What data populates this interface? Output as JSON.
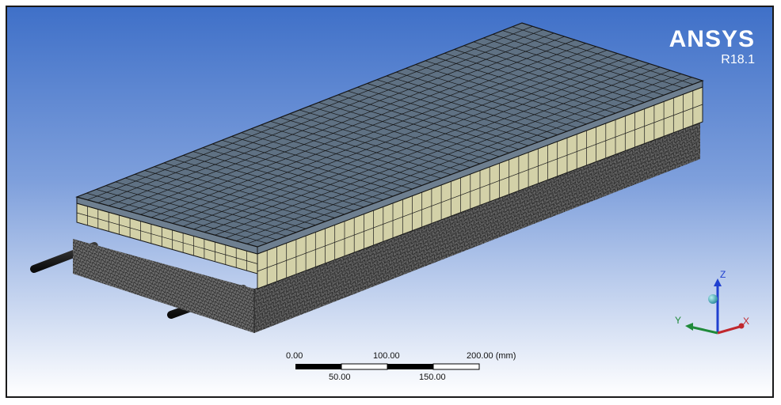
{
  "logo": {
    "word": "ANSYS",
    "version": "R18.1"
  },
  "scale_bar": {
    "top_labels": [
      "0.00",
      "100.00",
      "200.00 (mm)"
    ],
    "bottom_labels": [
      "50.00",
      "150.00"
    ]
  },
  "triad": {
    "x_label": "X",
    "y_label": "Y",
    "z_label": "Z"
  },
  "colors": {
    "background_top": "#3f70c8",
    "background_bottom": "#ffffff",
    "top_face": "#5f7183",
    "side_band": "#d3d1a8",
    "base": "#555555",
    "mesh_line": "#141414",
    "axis_x": "#c0282e",
    "axis_y": "#1f8a3a",
    "axis_z": "#2040d0"
  },
  "icons": {
    "triad": "coordinate-triad-icon"
  }
}
